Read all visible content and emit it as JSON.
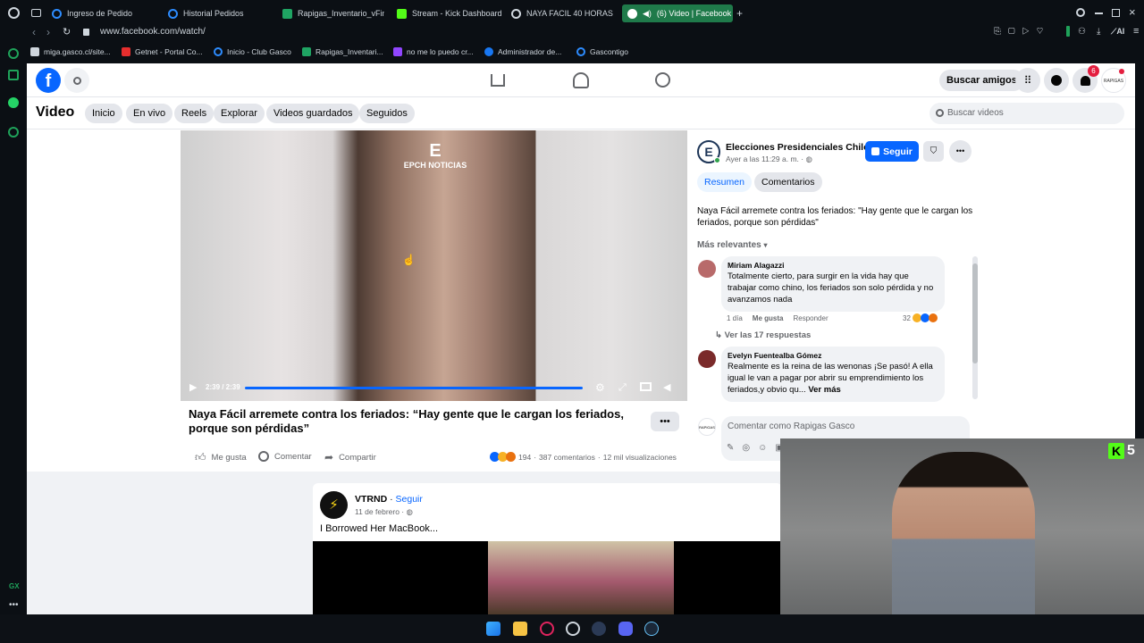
{
  "browser": {
    "tabs": [
      {
        "label": "Ingreso de Pedido"
      },
      {
        "label": "Historial Pedidos"
      },
      {
        "label": "Rapigas_Inventario_vFina"
      },
      {
        "label": "Stream - Kick Dashboard"
      },
      {
        "label": "NAYA FACIL 40 HORAS - I"
      },
      {
        "label": "(6) Video | Facebook"
      }
    ],
    "url": "www.facebook.com/watch/",
    "bookmarks": [
      {
        "label": "miga.gasco.cl/site..."
      },
      {
        "label": "Getnet - Portal Co..."
      },
      {
        "label": "Inicio - Club Gasco"
      },
      {
        "label": "Rapigas_Inventari..."
      },
      {
        "label": "no me lo puedo cr..."
      },
      {
        "label": "Administrador de..."
      },
      {
        "label": "Gascontigo"
      }
    ],
    "ai_label": "AI",
    "rail_bottom": "GX"
  },
  "facebook": {
    "header": {
      "find_friends": "Buscar amigos",
      "notifications_count": "6",
      "profile_label": "RAPIGAS"
    },
    "watch": {
      "title": "Video",
      "nav": [
        "Inicio",
        "En vivo",
        "Reels",
        "Explorar",
        "Videos guardados",
        "Seguidos"
      ],
      "search_placeholder": "Buscar videos"
    },
    "video": {
      "watermark": "EPCH NOTICIAS",
      "time": "2:39 / 2:39",
      "progress": 1.0,
      "title": "Naya Fácil arremete contra los feriados: “Hay gente que le cargan los feriados, porque son pérdidas”",
      "like": "Me gusta",
      "comment": "Comentar",
      "share": "Compartir",
      "reactions_count": "194",
      "comments_count": "387 comentarios",
      "views": "12 mil visualizaciones"
    },
    "sidepanel": {
      "page_name": "Elecciones Presidenciales Chile",
      "timestamp": "Ayer a las 11:29 a. m. ·",
      "follow": "Seguir",
      "tab_summary": "Resumen",
      "tab_comments": "Comentarios",
      "description": "Naya Fácil arremete contra los feriados: \"Hay gente que le cargan los feriados, porque son pérdidas\"",
      "sort": "Más relevantes",
      "comments": [
        {
          "author": "Miriam Alagazzi",
          "text": "Totalmente cierto, para surgir en la vida hay que trabajar como chino, los feriados son solo pérdida y no avanzamos nada",
          "age": "1 día",
          "like": "Me gusta",
          "reply": "Responder",
          "reactions": "32",
          "replies_link": "Ver las 17 respuestas"
        },
        {
          "author": "Evelyn Fuentealba Gómez",
          "text": "Realmente es la reina de las wenonas ¡Se pasó! A ella igual le van a pagar por abrir su emprendimiento los feriados,y obvio qu...",
          "more": "Ver más"
        }
      ],
      "comment_placeholder": "Comentar como Rapigas Gasco"
    },
    "feed_post": {
      "author": "VTRND",
      "follow": "Seguir",
      "date": "11 de febrero ·",
      "caption": "I Borrowed Her MacBook..."
    }
  },
  "overlay": {
    "kick_count": "5"
  },
  "colors": {
    "fb_blue": "#0866ff",
    "gx_green": "#1f7a4a",
    "badge_red": "#e41e3f"
  }
}
